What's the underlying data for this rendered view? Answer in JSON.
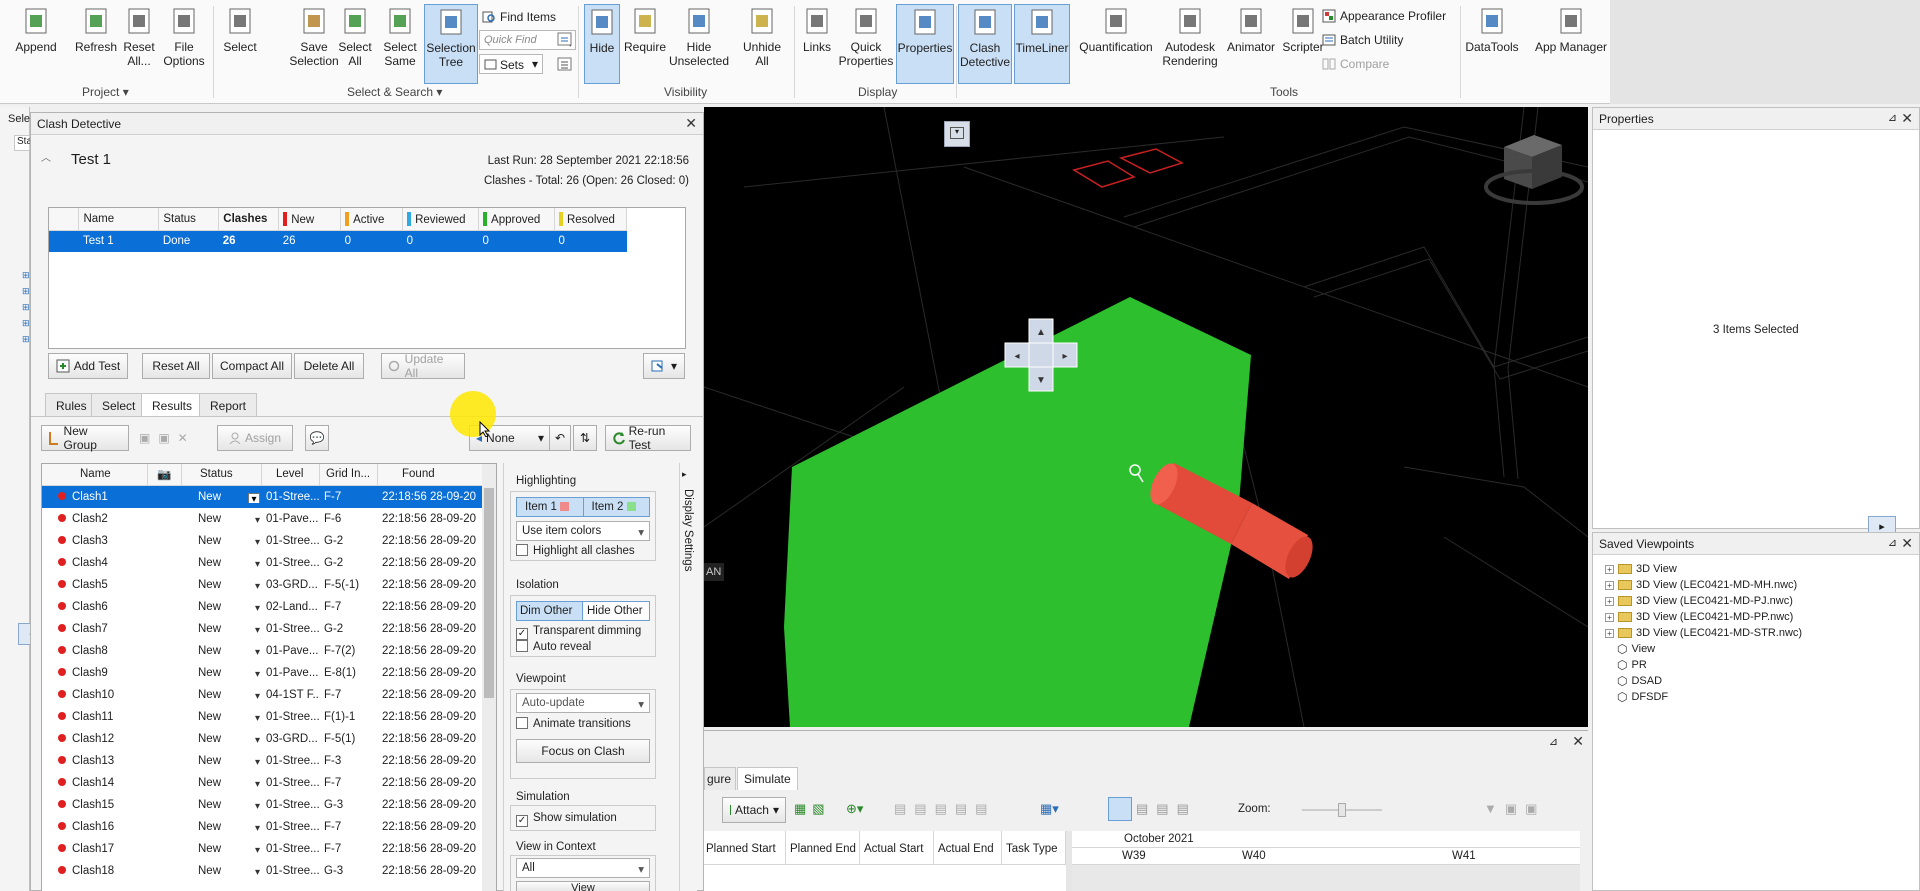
{
  "ribbon": {
    "buttons": [
      {
        "label": "Append",
        "icon": "append-icon"
      },
      {
        "label": "Refresh",
        "icon": "refresh-icon"
      },
      {
        "label": "Reset All...",
        "icon": "reset-icon"
      },
      {
        "label": "File Options",
        "icon": "file-options-icon"
      },
      {
        "label": "Select",
        "icon": "cursor-icon"
      },
      {
        "label": "Save Selection",
        "icon": "save-selection-icon"
      },
      {
        "label": "Select All",
        "icon": "select-all-icon"
      },
      {
        "label": "Select Same",
        "icon": "select-same-icon"
      },
      {
        "label": "Selection Tree",
        "icon": "selection-tree-icon"
      },
      {
        "label": "Hide",
        "icon": "hide-icon"
      },
      {
        "label": "Require",
        "icon": "require-icon"
      },
      {
        "label": "Hide Unselected",
        "icon": "hide-unselected-icon"
      },
      {
        "label": "Unhide All",
        "icon": "unhide-icon"
      },
      {
        "label": "Links",
        "icon": "links-icon"
      },
      {
        "label": "Quick Properties",
        "icon": "quick-properties-icon"
      },
      {
        "label": "Properties",
        "icon": "properties-icon"
      },
      {
        "label": "Clash Detective",
        "icon": "clash-detective-icon"
      },
      {
        "label": "TimeLiner",
        "icon": "timeliner-icon"
      },
      {
        "label": "Quantification",
        "icon": "quantification-icon"
      },
      {
        "label": "Autodesk Rendering",
        "icon": "rendering-icon"
      },
      {
        "label": "Animator",
        "icon": "animator-icon"
      },
      {
        "label": "Scripter",
        "icon": "scripter-icon"
      },
      {
        "label": "DataTools",
        "icon": "datatools-icon"
      },
      {
        "label": "App Manager",
        "icon": "app-manager-icon"
      }
    ],
    "find_items": "Find Items",
    "quick_find_placeholder": "Quick Find",
    "sets": "Sets",
    "appearance_profiler": "Appearance Profiler",
    "batch_utility": "Batch Utility",
    "compare": "Compare",
    "groups": [
      "Project",
      "Select & Search",
      "Visibility",
      "Display",
      "Tools"
    ]
  },
  "clash": {
    "title": "Clash Detective",
    "test_name": "Test 1",
    "last_run": "Last Run:  28 September 2021 22:18:56",
    "summary": "Clashes - Total:  26  (Open:  26  Closed:  0)",
    "test_headers": [
      "Name",
      "Status",
      "Clashes",
      "New",
      "Active",
      "Reviewed",
      "Approved",
      "Resolved"
    ],
    "test_row": [
      "Test 1",
      "Done",
      "26",
      "26",
      "0",
      "0",
      "0",
      "0"
    ],
    "buttons": {
      "add_test": "Add Test",
      "reset_all": "Reset All",
      "compact_all": "Compact All",
      "delete_all": "Delete All",
      "update_all": "Update All"
    },
    "tabs": [
      "Rules",
      "Select",
      "Results",
      "Report"
    ],
    "new_group": "New Group",
    "assign": "Assign",
    "none": "None",
    "rerun": "Re-run Test",
    "result_headers": [
      "Name",
      "Status",
      "Level",
      "Grid In...",
      "Found"
    ],
    "results": [
      [
        "Clash1",
        "New",
        "01-Stree...",
        "F-7",
        "22:18:56 28-09-20"
      ],
      [
        "Clash2",
        "New",
        "01-Pave...",
        "F-6",
        "22:18:56 28-09-20"
      ],
      [
        "Clash3",
        "New",
        "01-Stree...",
        "G-2",
        "22:18:56 28-09-20"
      ],
      [
        "Clash4",
        "New",
        "01-Stree...",
        "G-2",
        "22:18:56 28-09-20"
      ],
      [
        "Clash5",
        "New",
        "03-GRD...",
        "F-5(-1)",
        "22:18:56 28-09-20"
      ],
      [
        "Clash6",
        "New",
        "02-Land...",
        "F-7",
        "22:18:56 28-09-20"
      ],
      [
        "Clash7",
        "New",
        "01-Stree...",
        "G-2",
        "22:18:56 28-09-20"
      ],
      [
        "Clash8",
        "New",
        "01-Pave...",
        "F-7(2)",
        "22:18:56 28-09-20"
      ],
      [
        "Clash9",
        "New",
        "01-Pave...",
        "E-8(1)",
        "22:18:56 28-09-20"
      ],
      [
        "Clash10",
        "New",
        "04-1ST F...",
        "F-7",
        "22:18:56 28-09-20"
      ],
      [
        "Clash11",
        "New",
        "01-Stree...",
        "F(1)-1",
        "22:18:56 28-09-20"
      ],
      [
        "Clash12",
        "New",
        "03-GRD...",
        "F-5(1)",
        "22:18:56 28-09-20"
      ],
      [
        "Clash13",
        "New",
        "01-Stree...",
        "F-3",
        "22:18:56 28-09-20"
      ],
      [
        "Clash14",
        "New",
        "01-Stree...",
        "F-7",
        "22:18:56 28-09-20"
      ],
      [
        "Clash15",
        "New",
        "01-Stree...",
        "G-3",
        "22:18:56 28-09-20"
      ],
      [
        "Clash16",
        "New",
        "01-Stree...",
        "F-7",
        "22:18:56 28-09-20"
      ],
      [
        "Clash17",
        "New",
        "01-Stree...",
        "F-7",
        "22:18:56 28-09-20"
      ],
      [
        "Clash18",
        "New",
        "01-Stree...",
        "G-3",
        "22:18:56 28-09-20"
      ]
    ],
    "display_settings": "Display Settings",
    "highlighting": "Highlighting",
    "item1": "Item 1",
    "item2": "Item 2",
    "use_item_colors": "Use item colors",
    "highlight_all": "Highlight all clashes",
    "isolation": "Isolation",
    "dim_other": "Dim Other",
    "hide_other": "Hide Other",
    "transparent_dimming": "Transparent dimming",
    "auto_reveal": "Auto reveal",
    "viewpoint": "Viewpoint",
    "auto_update": "Auto-update",
    "animate_transitions": "Animate transitions",
    "focus_on_clash": "Focus on Clash",
    "simulation": "Simulation",
    "show_simulation": "Show simulation",
    "view_in_context": "View in Context",
    "all": "All",
    "view": "View"
  },
  "viewport": {
    "label": "AN"
  },
  "properties": {
    "title": "Properties",
    "message": "3 Items Selected"
  },
  "saved_viewpoints": {
    "title": "Saved Viewpoints",
    "items": [
      "3D View",
      "3D View (LEC0421-MD-MH.nwc)",
      "3D View (LEC0421-MD-PJ.nwc)",
      "3D View (LEC0421-MD-PP.nwc)",
      "3D View (LEC0421-MD-STR.nwc)",
      "View",
      "PR",
      "DSAD",
      "DFSDF"
    ]
  },
  "timeliner": {
    "tabs": [
      "Configure",
      "Simulate"
    ],
    "tab_visible": [
      "gure",
      "Simulate"
    ],
    "attach": "Attach",
    "zoom": "Zoom:",
    "columns": [
      "Planned Start",
      "Planned End",
      "Actual Start",
      "Actual End",
      "Task Type"
    ],
    "month": "October 2021",
    "weeks": [
      "W39",
      "W40",
      "W41"
    ]
  },
  "left": {
    "select_tab": "Selec",
    "star": "Star"
  }
}
